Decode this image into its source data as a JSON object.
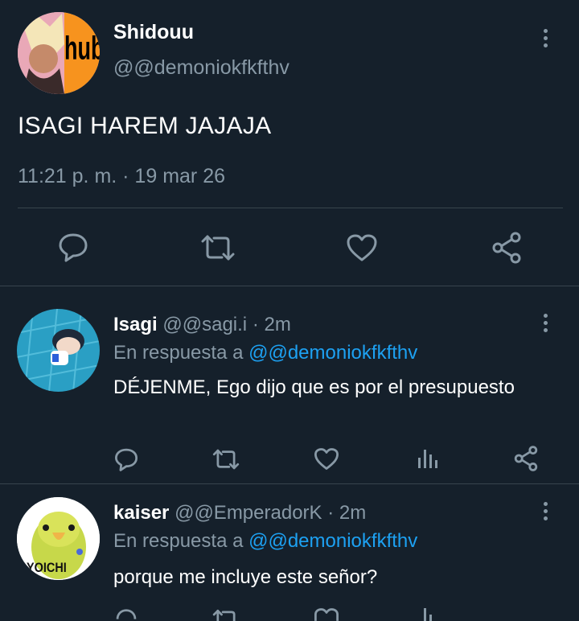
{
  "tweet": {
    "display_name": "Shidouu",
    "handle": "@@demoniokfkfthv",
    "avatar_text": "hub",
    "text": "ISAGI HAREM JAJAJA",
    "timestamp": "11:21 p. m. · 19 mar 26"
  },
  "replies": [
    {
      "display_name": "Isagi",
      "handle": "@@sagi.i",
      "time": "· 2m",
      "reply_prefix": "En respuesta a",
      "reply_to": "@@demoniokfkfthv",
      "text": "DÉJENME, Ego dijo que es por el presupuesto"
    },
    {
      "display_name": "kaiser",
      "handle": "@@EmperadorK",
      "time": "· 2m",
      "reply_prefix": "En respuesta a",
      "reply_to": "@@demoniokfkfthv",
      "text": "porque me incluye este señor?",
      "avatar_text": "YOICHI"
    }
  ],
  "icons": {
    "reply": "speech-bubble-icon",
    "retweet": "retweet-icon",
    "like": "heart-icon",
    "share": "share-icon",
    "analytics": "bar-chart-icon",
    "more": "kebab-icon"
  },
  "colors": {
    "background": "#15202b",
    "divider": "#38444d",
    "muted": "#8899a6",
    "link": "#1da1f2",
    "text": "#ffffff"
  }
}
